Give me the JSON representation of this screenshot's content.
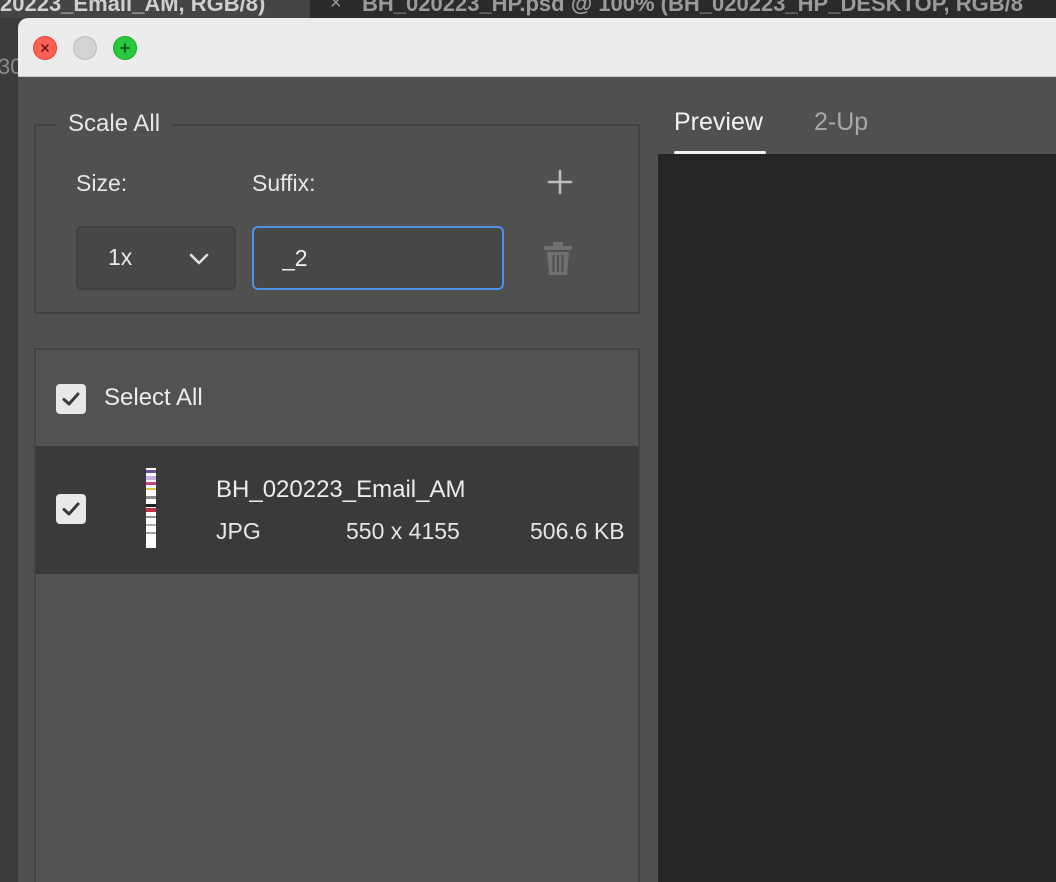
{
  "background_app": {
    "tab_active_title": "20223_Email_AM, RGB/8)",
    "tab_close_glyph": "×",
    "tab_inactive_title": "BH_020223_HP.psd @ 100% (BH_020223_HP_DESKTOP, RGB/8",
    "left_fragment": "30"
  },
  "titlebar": {
    "buttons": [
      "close",
      "minimize",
      "zoom"
    ]
  },
  "scale_all": {
    "legend": "Scale All",
    "size_label": "Size:",
    "suffix_label": "Suffix:",
    "size_value": "1x",
    "suffix_value": "_2",
    "add_icon": "plus-icon",
    "delete_icon": "trash-icon"
  },
  "file_list": {
    "select_all_label": "Select All",
    "select_all_checked": true,
    "files": [
      {
        "name": "BH_020223_Email_AM",
        "type": "JPG",
        "dimensions": "550 x 4155",
        "size": "506.6 KB",
        "checked": true
      }
    ]
  },
  "preview": {
    "tabs": [
      {
        "label": "Preview",
        "active": true
      },
      {
        "label": "2-Up",
        "active": false
      }
    ]
  },
  "colors": {
    "accent_focus": "#4d91e8",
    "panel_bg": "#505050",
    "preview_bg": "#262626",
    "selected_row_bg": "#3a3a3a"
  }
}
